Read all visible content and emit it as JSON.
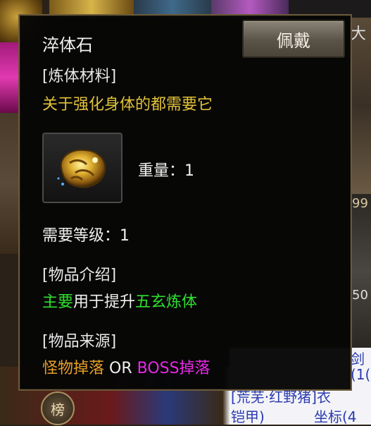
{
  "background": {
    "top_right_glyph": "大",
    "side_number_1": "99",
    "side_number_2": "50",
    "rank_button": "榜",
    "chat": {
      "line1": "剑",
      "line2": "(1(",
      "line3": "[荒芜·红野猪]衣",
      "line4_left": "铠甲)",
      "line4_right": "坐标(4"
    }
  },
  "tooltip": {
    "title": "淬体石",
    "equip_button": "佩戴",
    "category": "[炼体材料]",
    "description": "关于强化身体的都需要它",
    "weight": "重量：1",
    "required_level": "需要等级：1",
    "intro_heading": "[物品介绍]",
    "intro": {
      "part1": "主要",
      "part2": "用于提升",
      "part3": "五玄炼体"
    },
    "source_heading": "[物品来源]",
    "source": {
      "part1": "怪物掉落",
      "part2": " OR ",
      "part3": "BOSS掉落"
    }
  },
  "icons": {
    "item_icon": "gold-stone-icon"
  },
  "colors": {
    "description": "#e2c23a",
    "green_text": "#2ee02e",
    "orange_text": "#e8a028",
    "magenta_text": "#e828e8"
  }
}
